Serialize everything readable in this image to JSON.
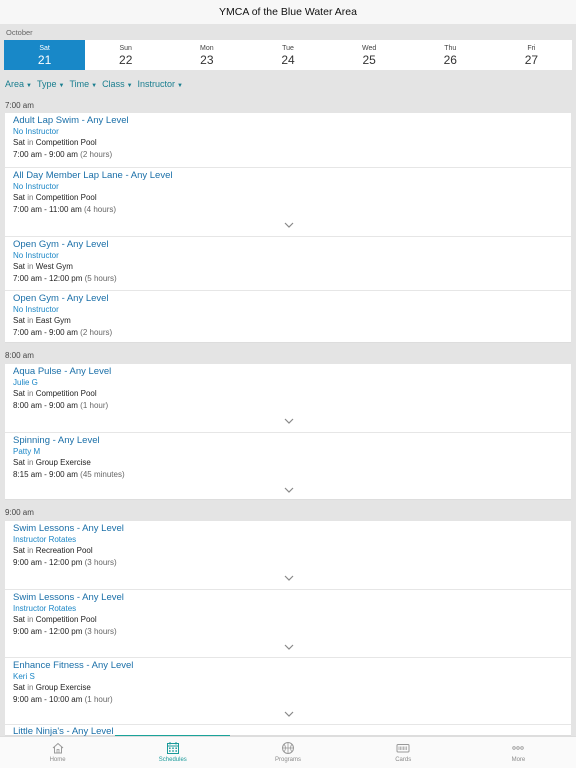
{
  "header": {
    "title": "YMCA of the Blue Water Area"
  },
  "month": "October",
  "days": [
    {
      "dow": "Sat",
      "num": "21",
      "selected": true
    },
    {
      "dow": "Sun",
      "num": "22"
    },
    {
      "dow": "Mon",
      "num": "23"
    },
    {
      "dow": "Tue",
      "num": "24"
    },
    {
      "dow": "Wed",
      "num": "25"
    },
    {
      "dow": "Thu",
      "num": "26"
    },
    {
      "dow": "Fri",
      "num": "27"
    }
  ],
  "filters": [
    "Area",
    "Type",
    "Time",
    "Class",
    "Instructor"
  ],
  "groups": [
    {
      "time": "7:00 am",
      "items": [
        {
          "cls": "Adult Lap Swim - Any Level",
          "inst": "No Instructor",
          "day": "Sat",
          "in": "in",
          "loc": "Competition Pool",
          "time": "7:00 am - 9:00 am",
          "dur": "(2 hours)",
          "chevron": false
        },
        {
          "cls": "All Day Member Lap Lane - Any Level",
          "inst": "No Instructor",
          "day": "Sat",
          "in": "in",
          "loc": "Competition Pool",
          "time": "7:00 am - 11:00 am",
          "dur": "(4 hours)",
          "chevron": true
        },
        {
          "cls": "Open Gym - Any Level",
          "inst": "No Instructor",
          "day": "Sat",
          "in": "in",
          "loc": "West Gym",
          "time": "7:00 am - 12:00 pm",
          "dur": "(5 hours)",
          "chevron": false
        },
        {
          "cls": "Open Gym - Any Level",
          "inst": "No Instructor",
          "day": "Sat",
          "in": "in",
          "loc": "East Gym",
          "time": "7:00 am - 9:00 am",
          "dur": "(2 hours)",
          "chevron": false
        }
      ]
    },
    {
      "time": "8:00 am",
      "items": [
        {
          "cls": "Aqua Pulse - Any Level",
          "inst": "Julie G",
          "day": "Sat",
          "in": "in",
          "loc": "Competition Pool",
          "time": "8:00 am - 9:00 am",
          "dur": "(1 hour)",
          "chevron": true
        },
        {
          "cls": "Spinning - Any Level",
          "inst": "Patty M",
          "day": "Sat",
          "in": "in",
          "loc": "Group Exercise",
          "time": "8:15 am - 9:00 am",
          "dur": "(45 minutes)",
          "chevron": true
        }
      ]
    },
    {
      "time": "9:00 am",
      "items": [
        {
          "cls": "Swim Lessons - Any Level",
          "inst": "Instructor Rotates",
          "day": "Sat",
          "in": "in",
          "loc": "Recreation Pool",
          "time": "9:00 am - 12:00 pm",
          "dur": "(3 hours)",
          "chevron": true
        },
        {
          "cls": "Swim Lessons - Any Level",
          "inst": "Instructor Rotates",
          "day": "Sat",
          "in": "in",
          "loc": "Competition Pool",
          "time": "9:00 am - 12:00 pm",
          "dur": "(3 hours)",
          "chevron": true
        },
        {
          "cls": "Enhance Fitness - Any Level",
          "inst": "Keri S",
          "day": "Sat",
          "in": "in",
          "loc": "Group Exercise",
          "time": "9:00 am - 10:00 am",
          "dur": "(1 hour)",
          "chevron": true
        },
        {
          "cls": "Little Ninja's - Any Level",
          "inst": "",
          "day": "",
          "in": "",
          "loc": "",
          "time": "",
          "dur": "",
          "chevron": false
        }
      ]
    }
  ],
  "tabs": [
    {
      "label": "Home",
      "icon": "home-icon"
    },
    {
      "label": "Schedules",
      "icon": "calendar-icon",
      "active": true
    },
    {
      "label": "Programs",
      "icon": "basketball-icon"
    },
    {
      "label": "Cards",
      "icon": "card-icon"
    },
    {
      "label": "More",
      "icon": "more-icon"
    }
  ],
  "colors": {
    "accent": "#1888c8",
    "link": "#1a6fa8",
    "teal": "#1a9a9a",
    "background": "#e4e4e4"
  }
}
